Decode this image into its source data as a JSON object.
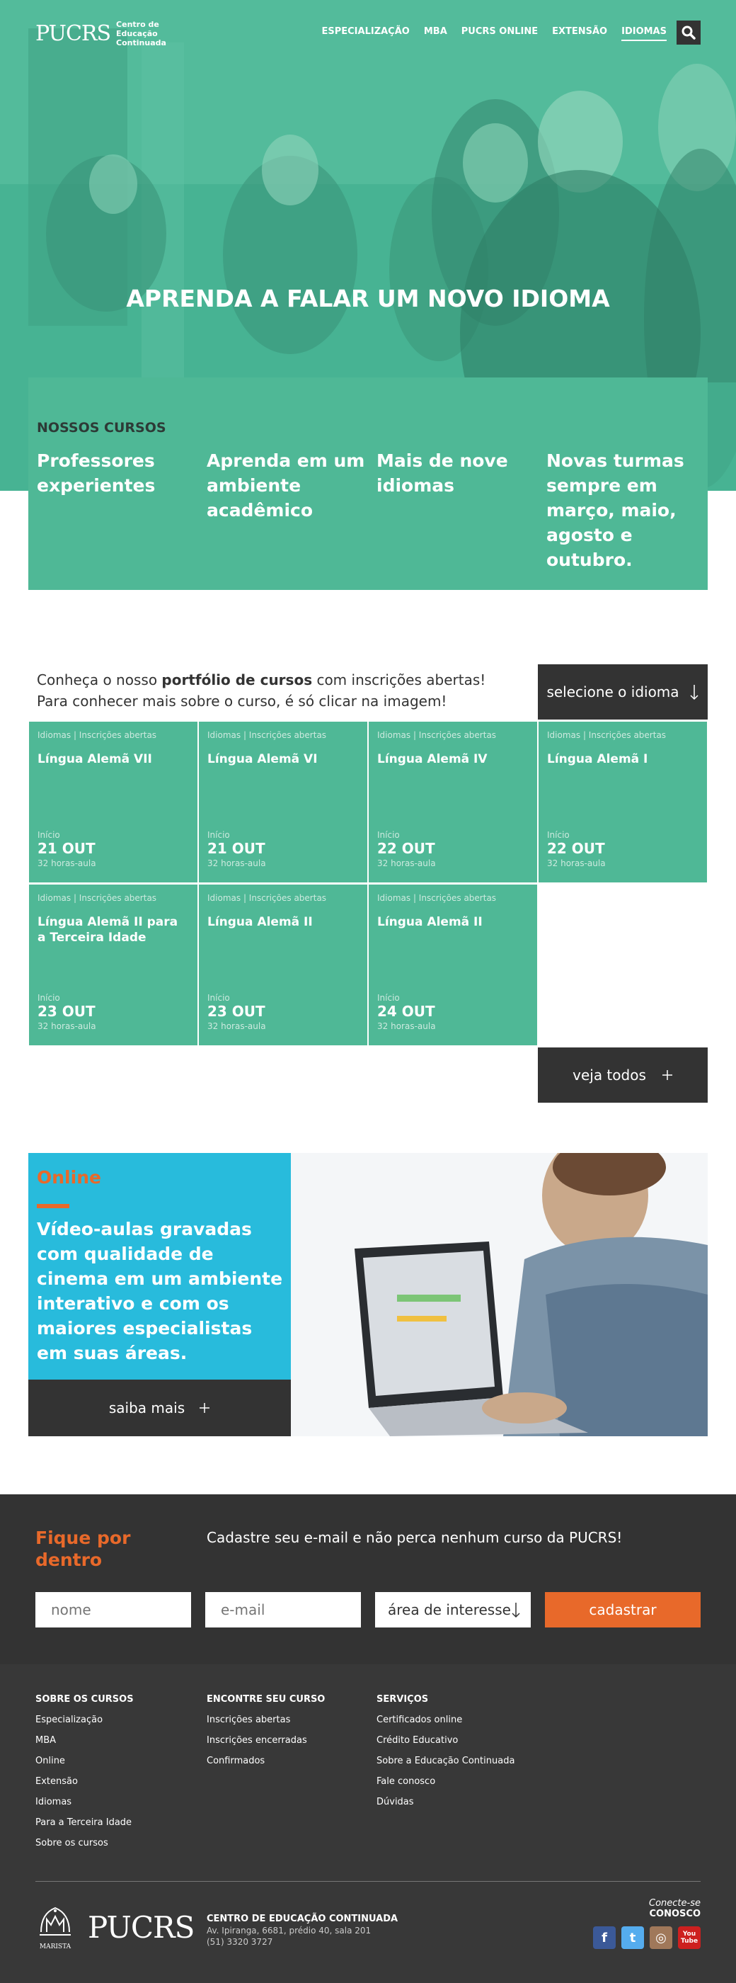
{
  "colors": {
    "green": "#4fb896",
    "dark": "#333333",
    "orange": "#e8692a",
    "cyan": "#28bbdc",
    "footer": "#383838"
  },
  "nav": {
    "logo": "PUCRS",
    "logo_sub_1": "Centro de",
    "logo_sub_2": "Educação Continuada",
    "links": [
      "ESPECIALIZAÇÃO",
      "MBA",
      "PUCRS ONLINE",
      "EXTENSÃO",
      "IDIOMAS"
    ],
    "active": "IDIOMAS",
    "search_icon": "search-icon"
  },
  "hero": {
    "title": "APRENDA A FALAR UM NOVO IDIOMA"
  },
  "features": {
    "heading": "NOSSOS CURSOS",
    "items": [
      "Professores experientes",
      "Aprenda em um ambiente acadêmico",
      "Mais de nove idiomas",
      "Novas turmas sempre em março, maio, agosto e outubro."
    ]
  },
  "portfolio": {
    "intro_1_a": "Conheça o nosso ",
    "intro_1_b": "portfólio de cursos",
    "intro_1_c": " com inscrições abertas!",
    "intro_2": "Para conhecer mais sobre o curso, é só clicar na imagem!",
    "select_label": "selecione o idioma",
    "see_all_label": "veja todos",
    "cards": [
      {
        "tag": "Idiomas | Inscrições abertas",
        "title": "Língua Alemã VII",
        "start_label": "Início",
        "date": "21 OUT",
        "hours": "32 horas-aula"
      },
      {
        "tag": "Idiomas | Inscrições abertas",
        "title": "Língua Alemã VI",
        "start_label": "Início",
        "date": "21 OUT",
        "hours": "32 horas-aula"
      },
      {
        "tag": "Idiomas | Inscrições abertas",
        "title": "Língua Alemã IV",
        "start_label": "Início",
        "date": "22 OUT",
        "hours": "32 horas-aula"
      },
      {
        "tag": "Idiomas | Inscrições abertas",
        "title": "Língua Alemã I",
        "start_label": "Início",
        "date": "22 OUT",
        "hours": "32 horas-aula"
      },
      {
        "tag": "Idiomas | Inscrições abertas",
        "title": "Língua Alemã II para a Terceira Idade",
        "start_label": "Início",
        "date": "23 OUT",
        "hours": "32 horas-aula"
      },
      {
        "tag": "Idiomas | Inscrições abertas",
        "title": "Língua Alemã II",
        "start_label": "Início",
        "date": "23 OUT",
        "hours": "32 horas-aula"
      },
      {
        "tag": "Idiomas | Inscrições abertas",
        "title": "Língua Alemã II",
        "start_label": "Início",
        "date": "24 OUT",
        "hours": "32 horas-aula"
      }
    ]
  },
  "online": {
    "label": "Online",
    "text": "Vídeo-aulas gravadas com qualidade de cinema em um ambiente interativo e com os maiores especialistas em suas áreas.",
    "button": "saiba mais"
  },
  "newsletter": {
    "title": "Fique por dentro",
    "text": "Cadastre seu e-mail e não perca nenhum curso da PUCRS!",
    "name_placeholder": "nome",
    "email_placeholder": "e-mail",
    "area_label": "área de interesse",
    "submit": "cadastrar"
  },
  "footer": {
    "col1": {
      "title": "SOBRE OS CURSOS",
      "links": [
        "Especialização",
        "MBA",
        "Online",
        "Extensão",
        "Idiomas",
        "Para a Terceira Idade",
        "Sobre os cursos"
      ]
    },
    "col2": {
      "title": "ENCONTRE SEU CURSO",
      "links": [
        "Inscrições abertas",
        "Inscrições encerradas",
        "Confirmados"
      ]
    },
    "col3": {
      "title": "SERVIÇOS",
      "links": [
        "Certificados online",
        "Crédito Educativo",
        "Sobre a Educação Continuada",
        "Fale conosco",
        "Dúvidas"
      ]
    },
    "marista": "MARISTA",
    "logo": "PUCRS",
    "address_title": "CENTRO DE EDUCAÇÃO CONTINUADA",
    "address_line": "Av. Ipiranga, 6681, prédio 40, sala 201",
    "phone": "(51) 3320 3727",
    "connect_a": "Conecte-se",
    "connect_b": "CONOSCO",
    "social": [
      {
        "icon": "facebook-icon",
        "glyph": "f",
        "color": "#3b5998"
      },
      {
        "icon": "twitter-icon",
        "glyph": "t",
        "color": "#55acee"
      },
      {
        "icon": "instagram-icon",
        "glyph": "◎",
        "color": "#a0785a"
      },
      {
        "icon": "youtube-icon",
        "glyph": "You Tube",
        "color": "#cd201f"
      }
    ]
  }
}
